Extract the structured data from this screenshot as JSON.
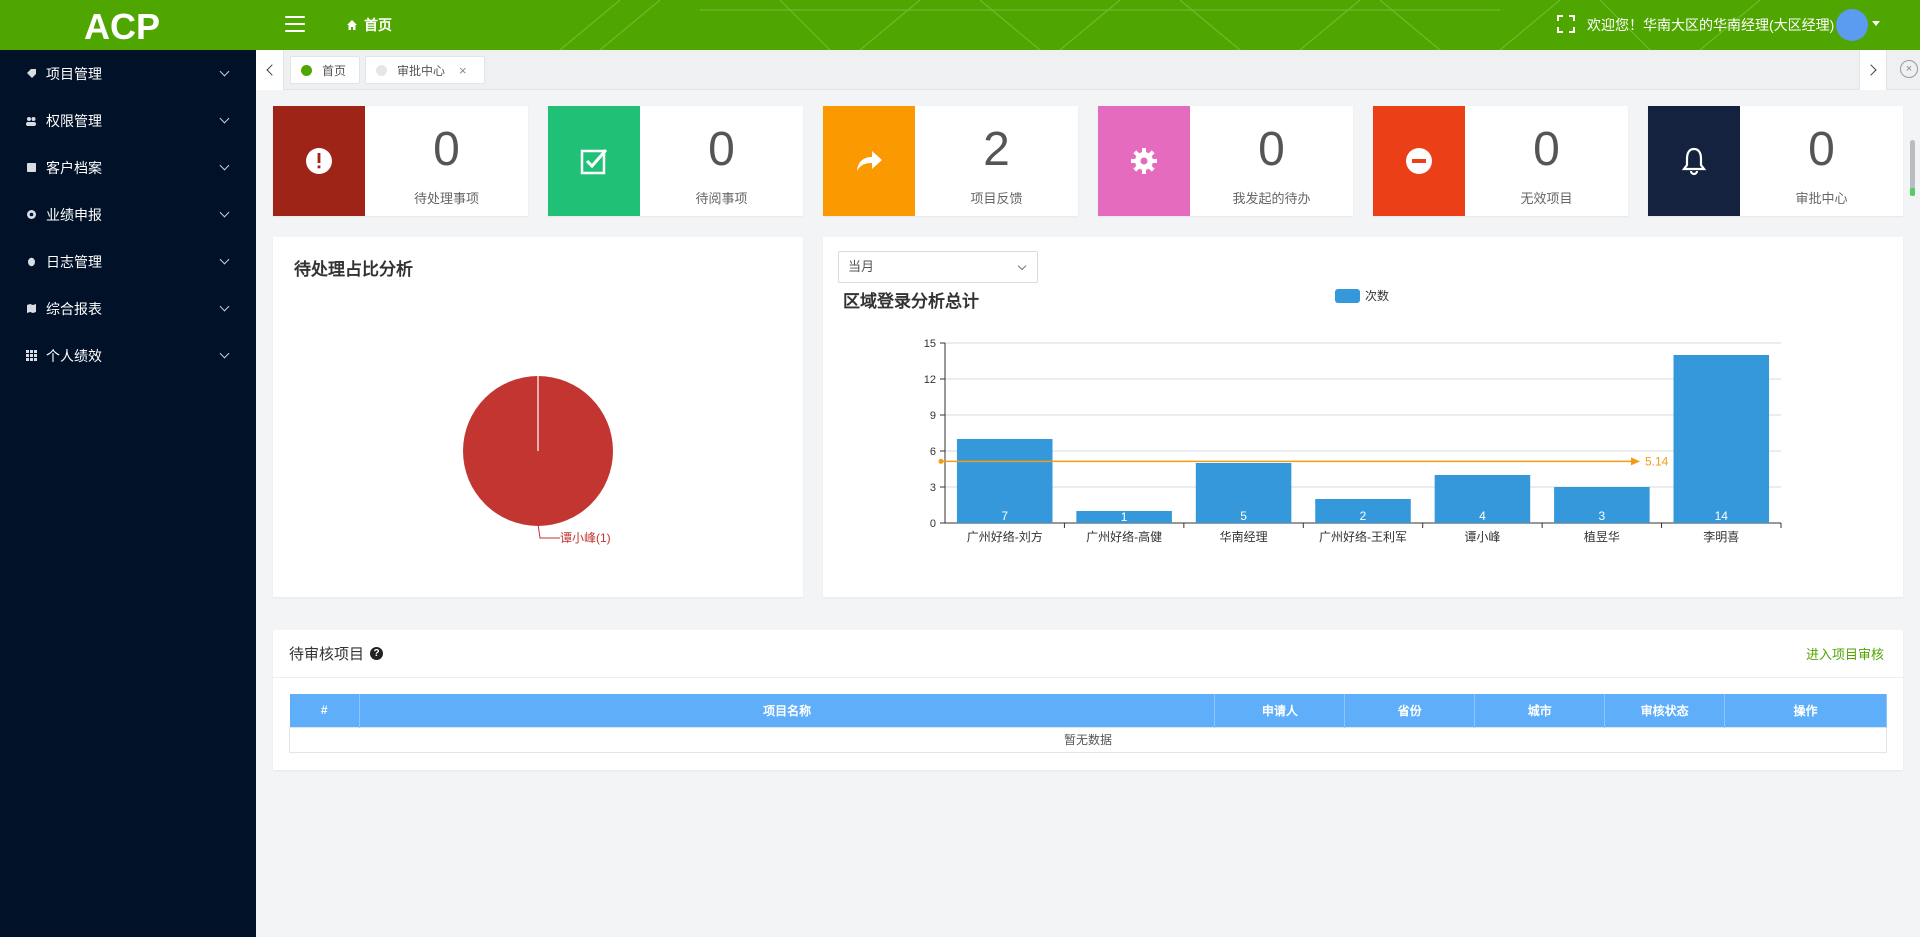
{
  "header": {
    "logo_text": "ACP",
    "home_label": "首页",
    "welcome_text": "欢迎您！华南大区的华南经理(大区经理)",
    "colors": {
      "bar": "#50a601"
    }
  },
  "sidebar": {
    "items": [
      {
        "label": "项目管理",
        "icon": "tag-icon"
      },
      {
        "label": "权限管理",
        "icon": "users-icon"
      },
      {
        "label": "客户档案",
        "icon": "book-icon"
      },
      {
        "label": "业绩申报",
        "icon": "gear-icon"
      },
      {
        "label": "日志管理",
        "icon": "bug-icon"
      },
      {
        "label": "综合报表",
        "icon": "map-icon"
      },
      {
        "label": "个人绩效",
        "icon": "grid-icon"
      }
    ]
  },
  "tabs": [
    {
      "label": "首页",
      "active": true
    },
    {
      "label": "审批中心",
      "active": false
    }
  ],
  "tab_close_symbol": "×",
  "stats": [
    {
      "value": "0",
      "label": "待处理事项",
      "color": "#9d2416",
      "icon": "exclamation-icon"
    },
    {
      "value": "0",
      "label": "待阅事项",
      "color": "#21c077",
      "icon": "check-square-icon"
    },
    {
      "value": "2",
      "label": "项目反馈",
      "color": "#fb9900",
      "icon": "share-arrow-icon"
    },
    {
      "value": "0",
      "label": "我发起的待办",
      "color": "#e56bbf",
      "icon": "gear-icon"
    },
    {
      "value": "0",
      "label": "无效项目",
      "color": "#ea3f17",
      "icon": "minus-circle-icon"
    },
    {
      "value": "0",
      "label": "审批中心",
      "color": "#14223f",
      "icon": "bell-icon"
    }
  ],
  "pie_panel": {
    "title": "待处理占比分析"
  },
  "bar_panel": {
    "title": "区域登录分析总计",
    "select_value": "当月"
  },
  "chart_data": [
    {
      "type": "pie",
      "slices": [
        {
          "label": "谭小峰(1)",
          "value": 1,
          "color": "#c23531"
        }
      ]
    },
    {
      "type": "bar",
      "categories": [
        "广州好络-刘方",
        "广州好络-高健",
        "华南经理",
        "广州好络-王利军",
        "谭小峰",
        "植昱华",
        "李明喜"
      ],
      "series": [
        {
          "name": "次数",
          "values": [
            7,
            1,
            5,
            2,
            4,
            3,
            14
          ],
          "color": "#3498db"
        }
      ],
      "average_line": {
        "value": 5.14,
        "label": "5.14",
        "color": "#f39c12"
      },
      "ylim": [
        0,
        15
      ],
      "yticks": [
        "0",
        "3",
        "6",
        "9",
        "12",
        "15"
      ],
      "legend": "top"
    }
  ],
  "audit": {
    "title": "待审核项目",
    "help_symbol": "?",
    "link_label": "进入项目审核",
    "columns": [
      "#",
      "项目名称",
      "申请人",
      "省份",
      "城市",
      "审核状态",
      "操作"
    ],
    "empty_text": "暂无数据"
  }
}
